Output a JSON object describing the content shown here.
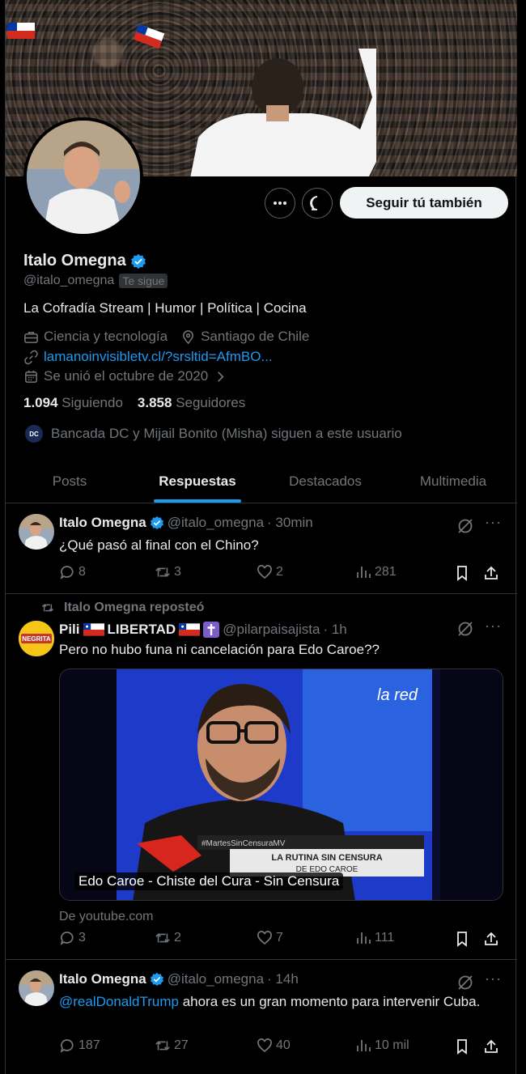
{
  "profile": {
    "name": "Italo Omegna",
    "handle": "@italo_omegna",
    "follows_you": "Te sigue",
    "bio": "La Cofradía Stream | Humor | Política | Cocina",
    "category": "Ciencia y tecnología",
    "location": "Santiago de Chile",
    "website": "lamanoinvisibletv.cl/?srsltid=AfmBO...",
    "joined": "Se unió el octubre de 2020",
    "following_count": "1.094",
    "following_label": "Siguiendo",
    "followers_count": "3.858",
    "followers_label": "Seguidores",
    "followed_by": "Bancada DC y Mijail Bonito (Misha) siguen a este usuario",
    "follow_button": "Seguir tú también",
    "mini_avatar_text": "DC"
  },
  "tabs": [
    {
      "label": "Posts"
    },
    {
      "label": "Respuestas"
    },
    {
      "label": "Destacados"
    },
    {
      "label": "Multimedia"
    }
  ],
  "posts": [
    {
      "name": "Italo Omegna",
      "handle": "@italo_omegna",
      "time": "· 30min",
      "text": "¿Qué pasó al final con el Chino?",
      "replies": "8",
      "reposts": "3",
      "likes": "2",
      "views": "281"
    },
    {
      "repost_label": "Italo Omegna reposteó",
      "name": "Pili 🇨🇱LIBERTAD🇨🇱✝️",
      "name_plain": "Pili",
      "name_tag": "LIBERTAD",
      "handle": "@pilarpaisajista",
      "time": "· 1h",
      "text": "Pero no hubo funa ni cancelación para Edo Caroe??",
      "avatar_text": "NEGRITA",
      "media_caption": "Edo Caroe - Chiste del Cura - Sin Censura",
      "media_banner_1": "#MartesSinCensuraMV",
      "media_banner_2": "LA RUTINA SIN CENSURA",
      "media_banner_3": "DE EDO CAROE",
      "media_logo": "la red",
      "source": "De youtube.com",
      "replies": "3",
      "reposts": "2",
      "likes": "7",
      "views": "111"
    },
    {
      "name": "Italo Omegna",
      "handle": "@italo_omegna",
      "time": "· 14h",
      "mention": "@realDonaldTrump",
      "text_after_mention": " ahora es un gran momento para intervenir Cuba.",
      "replies": "187",
      "reposts": "27",
      "likes": "40",
      "views": "10 mil"
    }
  ],
  "colors": {
    "background": "#000000",
    "text": "#e7e9ea",
    "muted": "#71767b",
    "accent": "#1d9bf0",
    "border": "#2f3336"
  }
}
